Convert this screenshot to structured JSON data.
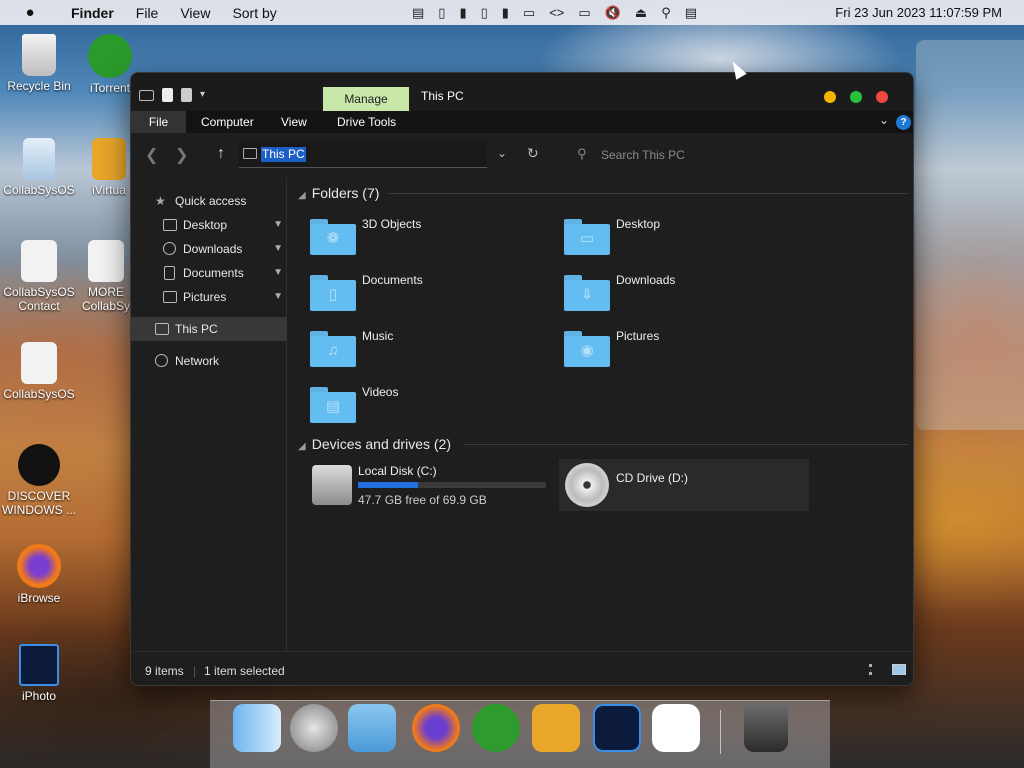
{
  "menubar": {
    "app": "Finder",
    "items": [
      "File",
      "View",
      "Sort by"
    ],
    "clock": "Fri 23 Jun 2023 11:07:59 PM"
  },
  "desktop_icons": [
    {
      "label": "Recycle Bin"
    },
    {
      "label": "iTorrent"
    },
    {
      "label": "CollabSysOS"
    },
    {
      "label": "iVirtua"
    },
    {
      "label": "CollabSysOS Contact"
    },
    {
      "label": "MORE CollabSy"
    },
    {
      "label": "CollabSysOS"
    },
    {
      "label": "DISCOVER WINDOWS ..."
    },
    {
      "label": "iBrowse"
    },
    {
      "label": "iPhoto"
    }
  ],
  "window": {
    "manage_tab": "Manage",
    "title": "This PC",
    "ribbon_tabs": [
      "File",
      "Computer",
      "View",
      "Drive Tools"
    ],
    "address": "This PC",
    "search_placeholder": "Search This PC"
  },
  "nav": {
    "quick_access": "Quick access",
    "items": [
      "Desktop",
      "Downloads",
      "Documents",
      "Pictures"
    ],
    "this_pc": "This PC",
    "network": "Network"
  },
  "content": {
    "folders_header": "Folders (7)",
    "folders": [
      "3D Objects",
      "Desktop",
      "Documents",
      "Downloads",
      "Music",
      "Pictures",
      "Videos"
    ],
    "devices_header": "Devices and drives (2)",
    "drives": [
      {
        "name": "Local Disk (C:)",
        "free": "47.7 GB free of 69.9 GB",
        "used_fraction": 0.32
      },
      {
        "name": "CD Drive (D:)"
      }
    ]
  },
  "status": {
    "items": "9 items",
    "selected": "1 item selected"
  },
  "colors": {
    "folder": "#64bdf0",
    "manage_tab": "#c9e7a9",
    "selection": "#1d5fc4",
    "disk_bar": "#1f6fe0"
  }
}
